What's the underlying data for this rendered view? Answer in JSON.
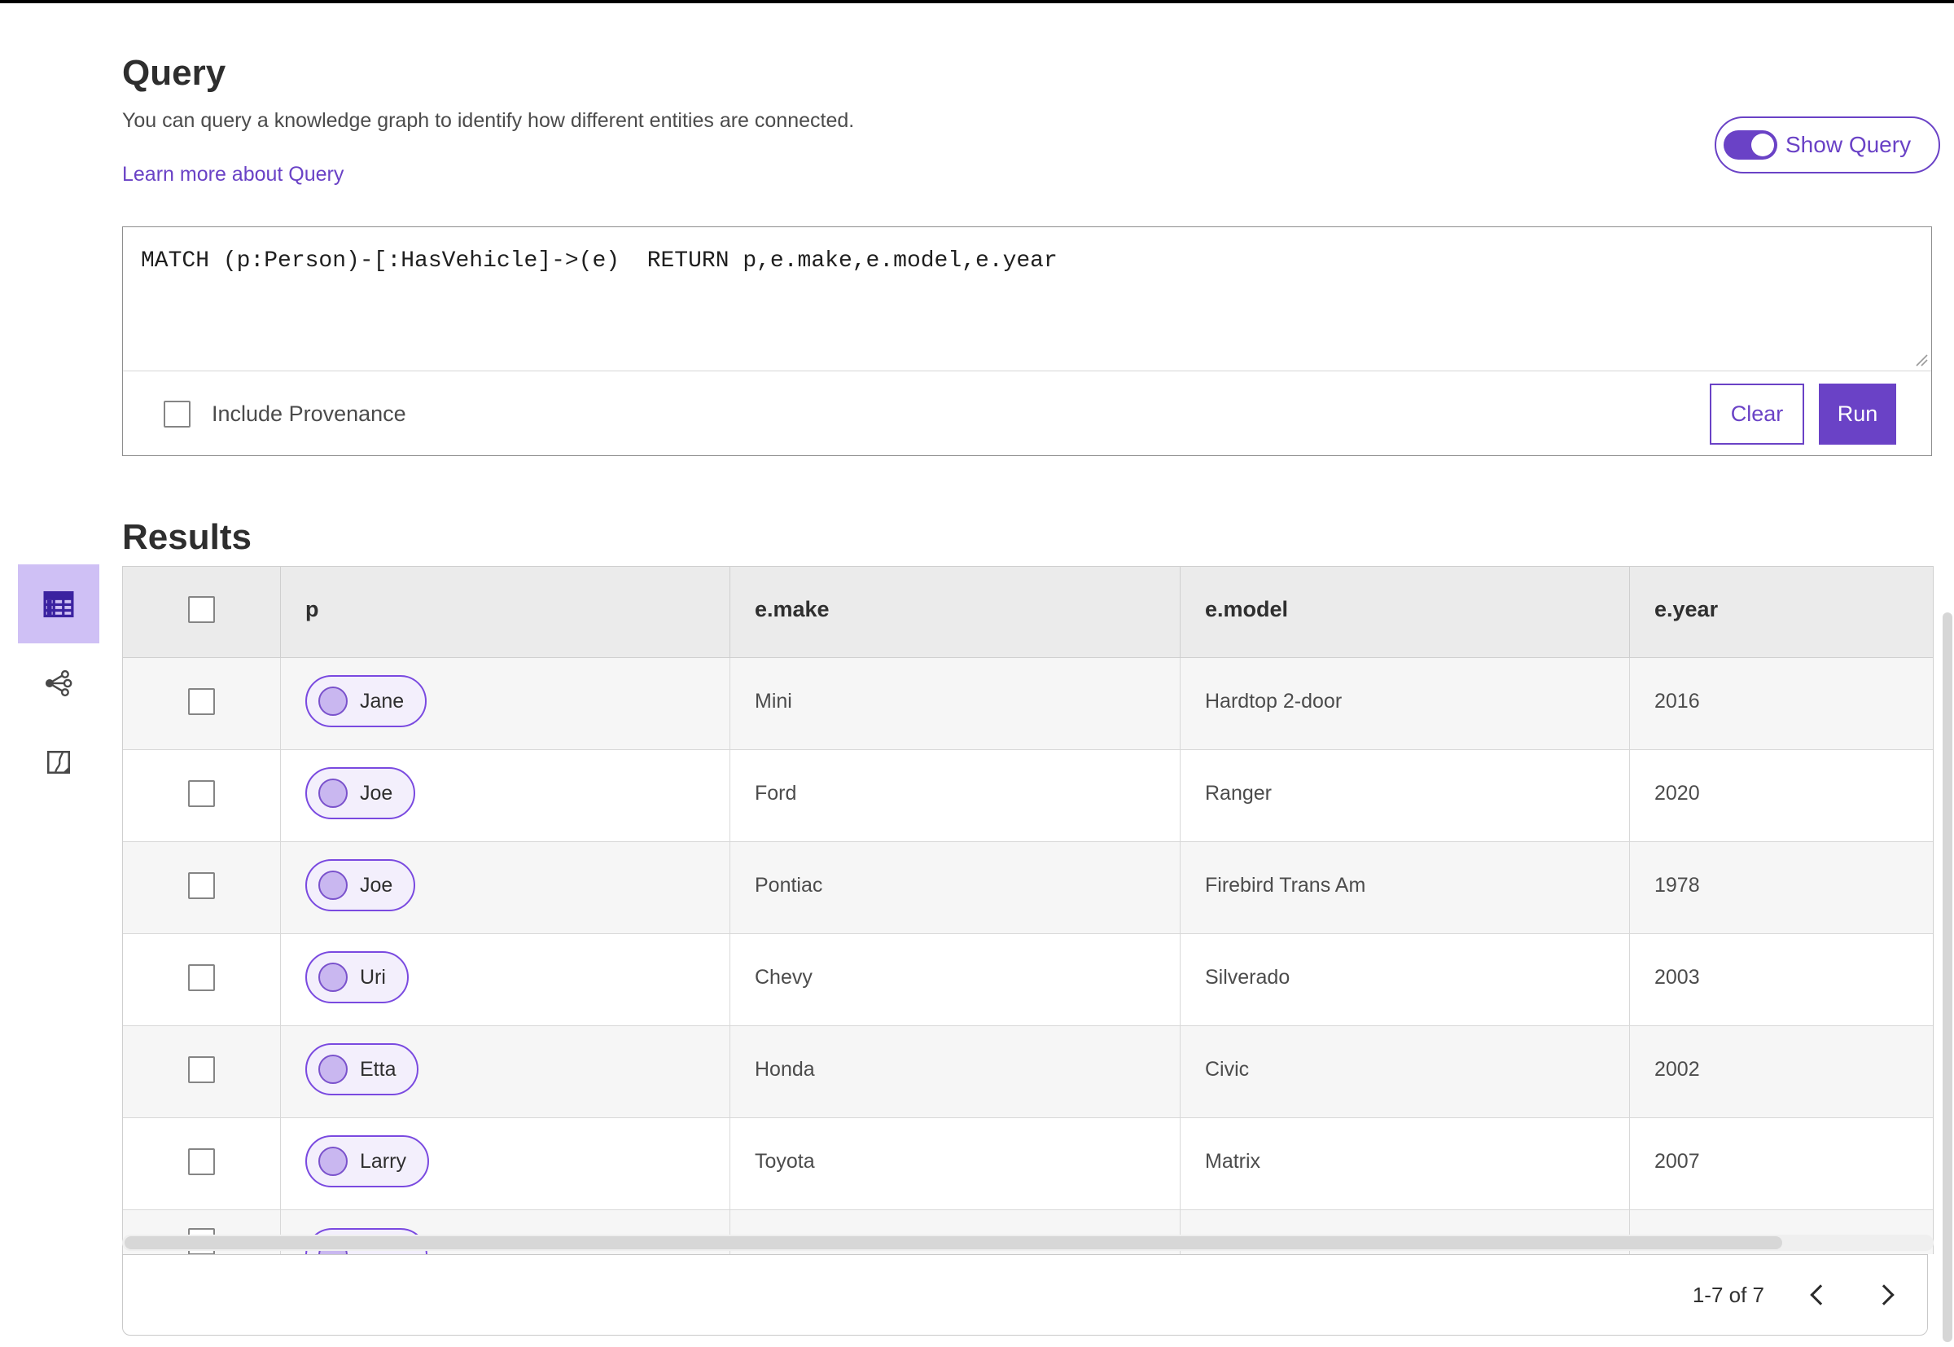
{
  "colors": {
    "brand_purple": "#6a42c6",
    "tile_selected_bg": "#cfc0f5",
    "tile_icon_purple": "#3b22a0",
    "chip_border": "#7a4ae0",
    "chip_bg": "#f3effc",
    "chip_circle": "#c9b7f0",
    "table_header_bg": "#ebebeb",
    "row_stripe": "#f6f6f6"
  },
  "query_panel": {
    "title": "Query",
    "description": "You can query a knowledge graph to identify how different entities are connected.",
    "learn_more_link": "Learn more about Query",
    "show_query_toggle": {
      "label": "Show Query",
      "state": "on"
    },
    "query_input_value": "MATCH (p:Person)-[:HasVehicle]->(e)  RETURN p,e.make,e.model,e.year",
    "include_provenance": {
      "label": "Include Provenance",
      "checked": false
    },
    "clear_button": "Clear",
    "run_button": "Run"
  },
  "results_panel": {
    "title": "Results",
    "view_switcher": [
      {
        "icon": "table-view-icon",
        "selected": true
      },
      {
        "icon": "link-chart-view-icon",
        "selected": false
      },
      {
        "icon": "map-view-icon",
        "selected": false
      }
    ],
    "table": {
      "columns": [
        "p",
        "e.make",
        "e.model",
        "e.year"
      ],
      "rows": [
        {
          "p": "Jane",
          "e_make": "Mini",
          "e_model": "Hardtop 2-door",
          "e_year": "2016",
          "partial": false
        },
        {
          "p": "Joe",
          "e_make": "Ford",
          "e_model": "Ranger",
          "e_year": "2020",
          "partial": false
        },
        {
          "p": "Joe",
          "e_make": "Pontiac",
          "e_model": "Firebird Trans Am",
          "e_year": "1978",
          "partial": false
        },
        {
          "p": "Uri",
          "e_make": "Chevy",
          "e_model": "Silverado",
          "e_year": "2003",
          "partial": false
        },
        {
          "p": "Etta",
          "e_make": "Honda",
          "e_model": "Civic",
          "e_year": "2002",
          "partial": false
        },
        {
          "p": "Larry",
          "e_make": "Toyota",
          "e_model": "Matrix",
          "e_year": "2007",
          "partial": false
        },
        {
          "p": "",
          "e_make": "",
          "e_model": "",
          "e_year": "",
          "partial": true
        }
      ]
    },
    "pagination": {
      "range_label": "1-7 of 7",
      "prev_icon": "chevron-left-icon",
      "next_icon": "chevron-right-icon"
    }
  }
}
